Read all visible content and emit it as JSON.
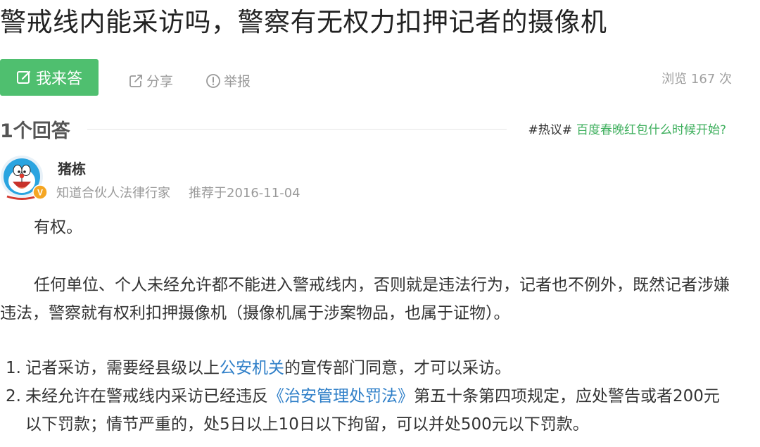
{
  "question": {
    "title": "警戒线内能采访吗，警察有无权力扣押记者的摄像机"
  },
  "toolbar": {
    "answer_label": "我来答",
    "share_label": "分享",
    "report_label": "举报",
    "views_text": "浏览 167 次"
  },
  "answers_section": {
    "count_label": "1个回答",
    "hot_tag": "#热议#",
    "hot_link": "百度春晚红包什么时候开始?"
  },
  "answer": {
    "author": "猪栋",
    "author_title": "知道合伙人法律行家",
    "recommend_date": "推荐于2016-11-04",
    "verified_badge": "V",
    "p1": "有权。",
    "p2": "任何单位、个人未经允许都不能进入警戒线内，否则就是违法行为，记者也不例外，既然记者涉嫌违法，警察就有权利扣押摄像机（摄像机属于涉案物品，也属于证物）。",
    "list": [
      {
        "num": "1.",
        "pre": "记者采访，需要经县级以上",
        "link": "公安机关",
        "post": "的宣传部门同意，才可以采访。"
      },
      {
        "num": "2.",
        "pre": "未经允许在警戒线内采访已经违反",
        "link": "《治安管理处罚法》",
        "post": "第五十条第四项规定，应处警告或者200元以下罚款；情节严重的，处5日以上10日以下拘留，可以并处500元以下罚款。"
      }
    ]
  },
  "colors": {
    "accent_green": "#4fbf6f",
    "link_green": "#3eaf5d",
    "link_blue": "#2f7fc8",
    "muted_gray": "#999999"
  },
  "icons": {
    "answer": "edit-icon",
    "share": "share-icon",
    "report": "alert-circle-icon",
    "badge": "verified-badge-icon"
  }
}
